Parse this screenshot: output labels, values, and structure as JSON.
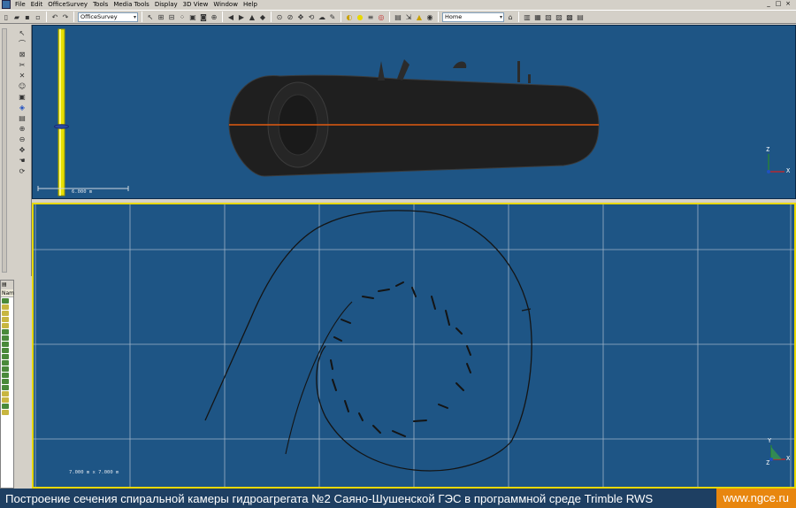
{
  "menu": {
    "items": [
      "File",
      "Edit",
      "OfficeSurvey",
      "Tools",
      "Media Tools",
      "Display",
      "3D View",
      "Window",
      "Help"
    ],
    "window_controls": [
      "_",
      "□",
      "×"
    ]
  },
  "toolbar": {
    "project_combo": "OfficeSurvey",
    "view_combo": "Home"
  },
  "left_panel": {
    "column_header": "Nam"
  },
  "top_view": {
    "scale_label": "6.000 m",
    "axis_z": "Z",
    "axis_x": "X"
  },
  "bottom_view": {
    "grid_label": "7.000 m x 7.000 m",
    "axis_y": "Y",
    "axis_z": "Z",
    "axis_x": "X"
  },
  "caption": {
    "text": "Построение сечения спиральной камеры гидроагрегата №2 Саяно-Шушенской ГЭС в программной среде Trimble RWS",
    "site": "www.ngce.ru"
  },
  "colors": {
    "viewport_bg": "#1e5585",
    "selection_border": "#e8d800",
    "section_line": "#e05a10",
    "caption_bg": "#1e3f62",
    "site_bg": "#e8860e"
  }
}
